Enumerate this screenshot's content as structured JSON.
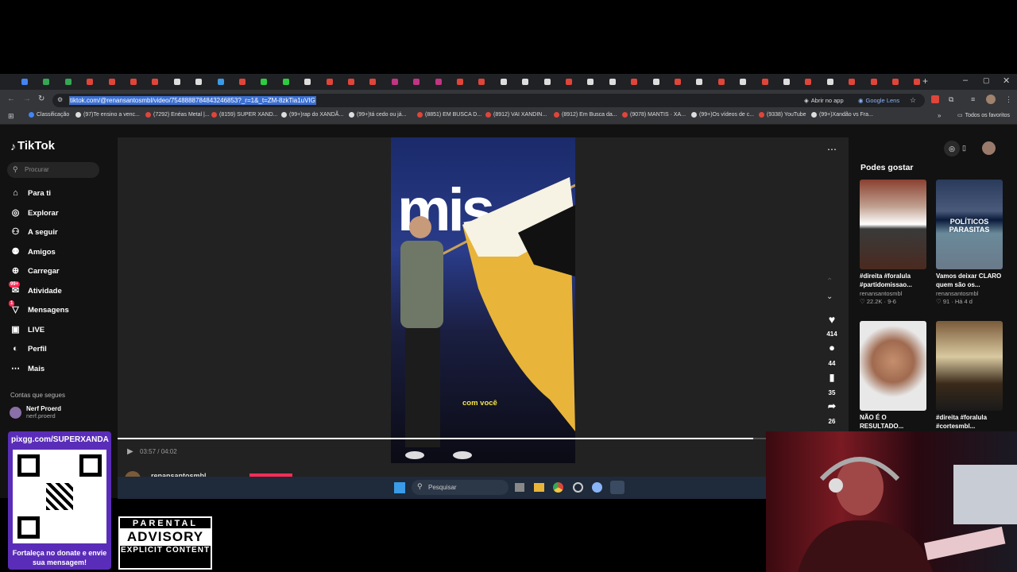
{
  "browser": {
    "url": "tiktok.com/@renansantosmbl/video/7548888784843246853?_r=1&_t=ZM-8zkTia1uVIG",
    "open_in_app": "Abrir no app",
    "google_lens": "Google Lens",
    "all_favorites": "Todos os favoritos",
    "bookmarks": [
      "Classificação",
      "(97)Te ensino a venc...",
      "(7292) Enéas Metal |...",
      "(8159) SUPER XAND...",
      "(99+)rap do XANDÃ...",
      "(99+)tá cedo ou já...",
      "(8851) EM BUSCA D...",
      "(8912) VAI XANDIN...",
      "(8912) Em Busca da...",
      "(9078) MANTIS · XA...",
      "(99+)Os vídeos de c...",
      "(9338) YouTube",
      "(99+)Xandão vs Fra..."
    ]
  },
  "sidebar": {
    "logo": "TikTok",
    "search_placeholder": "Procurar",
    "items": [
      {
        "label": "Para ti"
      },
      {
        "label": "Explorar"
      },
      {
        "label": "A seguir"
      },
      {
        "label": "Amigos"
      },
      {
        "label": "Carregar"
      },
      {
        "label": "Atividade",
        "badge": "99+"
      },
      {
        "label": "Mensagens",
        "badge": "1"
      },
      {
        "label": "LIVE"
      },
      {
        "label": "Perfil"
      },
      {
        "label": "Mais"
      }
    ],
    "following_title": "Contas que segues",
    "following": [
      {
        "name": "Nerf Proerd",
        "handle": "nerf.proerd"
      }
    ]
  },
  "video": {
    "caption": "com você",
    "banner_text": "mis",
    "time": "03:57 / 04:02",
    "progress": 0.98,
    "author": "renansantosmbl",
    "actions": {
      "likes": "414",
      "comments": "44",
      "saves": "35",
      "shares": "26"
    }
  },
  "suggestions": {
    "title": "Podes gostar",
    "items": [
      {
        "title": "#direita #foralula #partidomissao...",
        "author": "renansantosmbl",
        "likes": "22.2K",
        "date": "9-6"
      },
      {
        "title": "Vamos deixar CLARO quem são os...",
        "author": "renansantosmbl",
        "likes": "91",
        "date": "Há 4 d",
        "overlay": "POLÍTICOS PARASITAS"
      },
      {
        "title": "NÃO É O RESULTADO...",
        "author": "",
        "likes": "",
        "date": ""
      },
      {
        "title": "#direita #foralula #cortesmbl...",
        "author": "",
        "likes": "",
        "date": ""
      }
    ]
  },
  "taskbar": {
    "search_placeholder": "Pesquisar"
  },
  "overlay": {
    "qr_url": "pixgg.com/SUPERXANDA",
    "qr_caption": "Fortaleça no donate e envie sua mensagem!",
    "advisory": {
      "line1": "PARENTAL",
      "line2": "ADVISORY",
      "line3": "EXPLICIT CONTENT"
    }
  },
  "colors": {
    "accent": "#fe2c55",
    "caption": "#f5e642",
    "flag": "#e8b53a"
  }
}
